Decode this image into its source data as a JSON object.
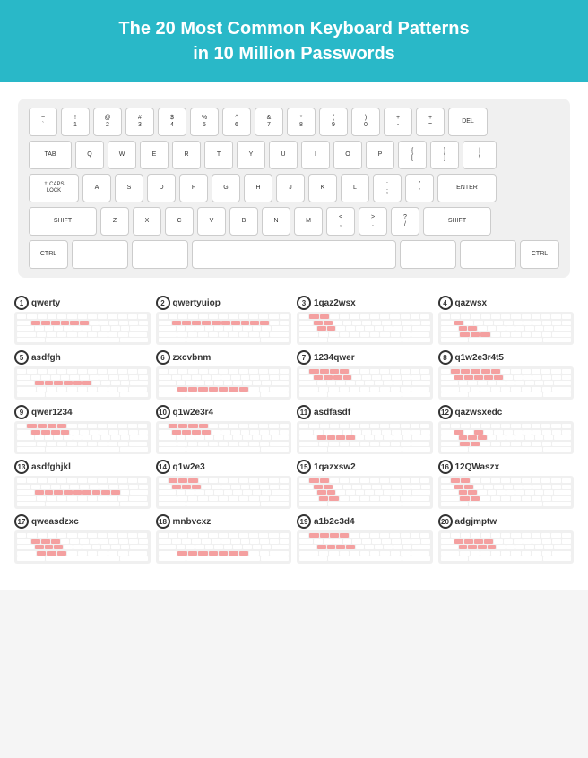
{
  "header": {
    "line1": "The 20 Most Common Keyboard Patterns",
    "line2": "in 10 Million Passwords"
  },
  "keyboard": {
    "rows": [
      [
        "` ~",
        "! 1",
        "@ 2",
        "# 3",
        "$ 4",
        "% 5",
        "^ 6",
        "& 7",
        "* 8",
        "( 9",
        ") 0",
        "- =",
        "+ =",
        "DEL"
      ],
      [
        "TAB",
        "Q",
        "W",
        "E",
        "R",
        "T",
        "Y",
        "U",
        "I",
        "O",
        "P",
        "{ [",
        "} ]",
        "| \\"
      ],
      [
        "CAPS LOCK",
        "A",
        "S",
        "D",
        "F",
        "G",
        "H",
        "J",
        "K",
        "L",
        ": ;",
        "\" '",
        "ENTER"
      ],
      [
        "SHIFT",
        "Z",
        "X",
        "C",
        "V",
        "B",
        "N",
        "M",
        "< ,",
        "> .",
        "? /",
        "SHIFT"
      ],
      [
        "CTRL",
        "",
        "",
        "",
        "",
        "CTRL"
      ]
    ]
  },
  "patterns": [
    {
      "num": 1,
      "label": "qwerty"
    },
    {
      "num": 2,
      "label": "qwertyuiop"
    },
    {
      "num": 3,
      "label": "1qaz2wsx"
    },
    {
      "num": 4,
      "label": "qazwsx"
    },
    {
      "num": 5,
      "label": "asdfgh"
    },
    {
      "num": 6,
      "label": "zxcvbnm"
    },
    {
      "num": 7,
      "label": "1234qwer"
    },
    {
      "num": 8,
      "label": "q1w2e3r4t5"
    },
    {
      "num": 9,
      "label": "qwer1234"
    },
    {
      "num": 10,
      "label": "q1w2e3r4"
    },
    {
      "num": 11,
      "label": "asdfasdf"
    },
    {
      "num": 12,
      "label": "qazwsxedc"
    },
    {
      "num": 13,
      "label": "asdfghjkl"
    },
    {
      "num": 14,
      "label": "q1w2e3"
    },
    {
      "num": 15,
      "label": "1qazxsw2"
    },
    {
      "num": 16,
      "label": "12QWaszx"
    },
    {
      "num": 17,
      "label": "qweasdzxc"
    },
    {
      "num": 18,
      "label": "mnbvcxz"
    },
    {
      "num": 19,
      "label": "a1b2c3d4"
    },
    {
      "num": 20,
      "label": "adgjmptw"
    }
  ]
}
